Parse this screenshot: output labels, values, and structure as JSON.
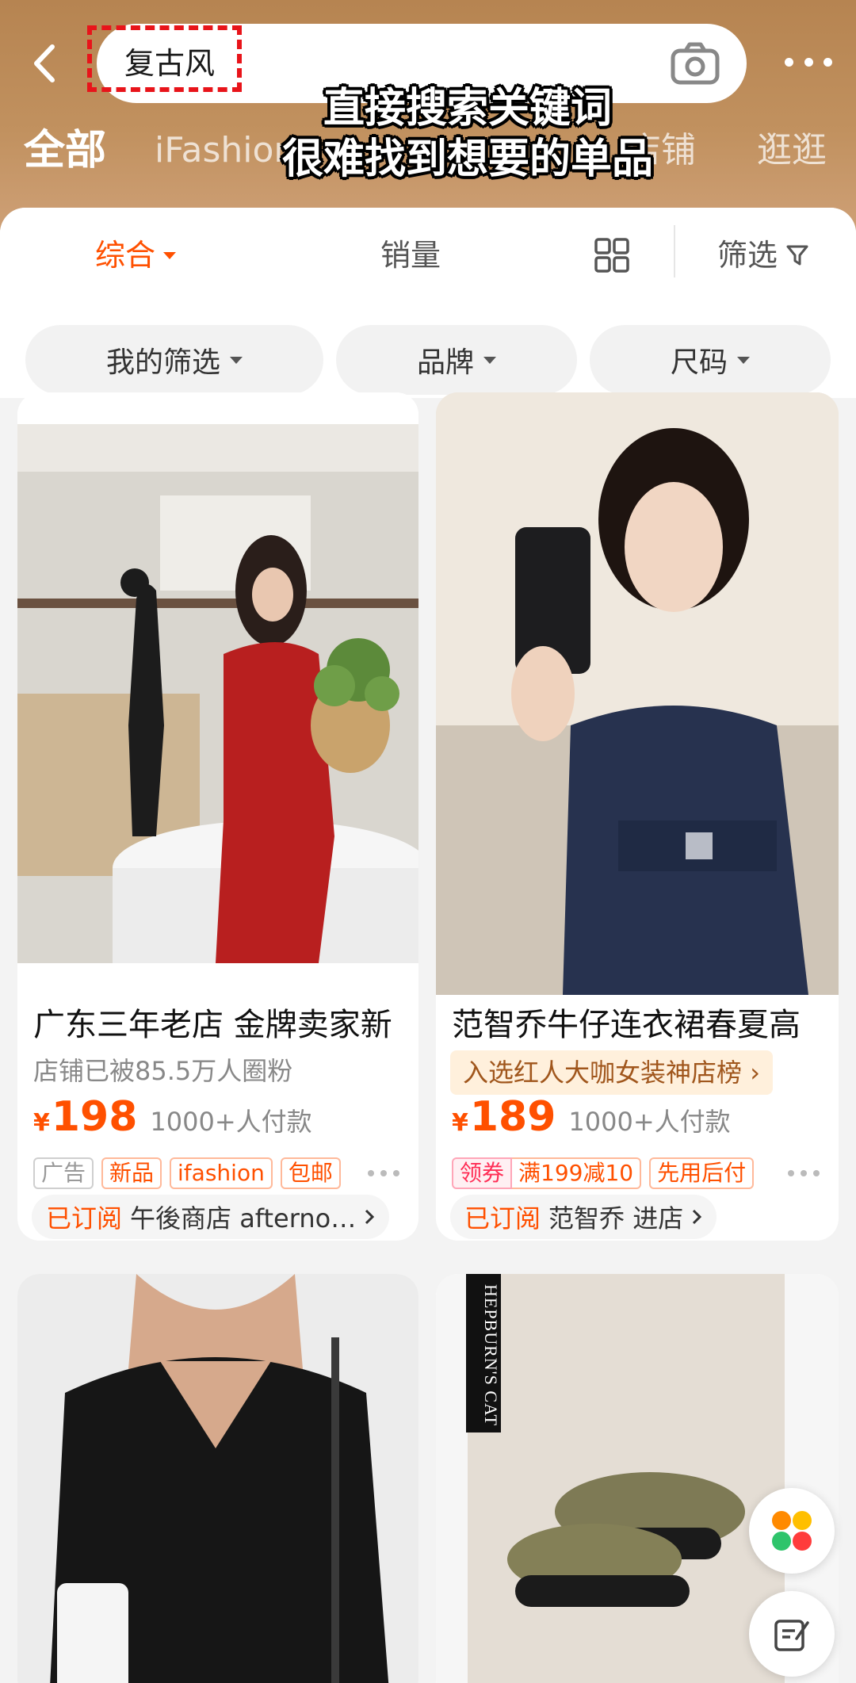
{
  "header": {
    "search_query": "复古风",
    "tabs": [
      "全部",
      "iFashion",
      "店铺",
      "逛逛"
    ],
    "overlay_caption": [
      "直接搜索关键词",
      "很难找到想要的单品"
    ]
  },
  "sortbar": {
    "items": [
      "综合",
      "销量",
      "筛选"
    ]
  },
  "chips": [
    "我的筛选",
    "品牌",
    "尺码"
  ],
  "products": [
    {
      "title": "广东三年老店 金牌卖家新",
      "subtitle": "店铺已被85.5万人圈粉",
      "currency": "¥",
      "price": "198",
      "sold": "1000+人付款",
      "tags": [
        "广告",
        "新品",
        "ifashion",
        "包邮"
      ],
      "subscribed": "已订阅",
      "shop": "午後商店 afterno…"
    },
    {
      "title": "范智乔牛仔连衣裙春夏高",
      "rank_banner": "入选红人大咖女装神店榜",
      "currency": "¥",
      "price": "189",
      "sold": "1000+人付款",
      "tags": [
        "领券",
        "满199减10",
        "先用后付"
      ],
      "subscribed": "已订阅",
      "shop": "范智乔 进店"
    },
    {
      "image_text": ""
    },
    {
      "image_text": "HEPBURN'S CAT"
    }
  ],
  "colors": {
    "accent": "#ff5000",
    "header_bg": "#c1915f",
    "highlight_box": "#e8141a"
  },
  "icons": [
    "back-icon",
    "camera-icon",
    "more-icon",
    "caret-down-icon",
    "grid-view-icon",
    "filter-icon",
    "chevron-right-icon",
    "apps-icon",
    "edit-icon"
  ]
}
